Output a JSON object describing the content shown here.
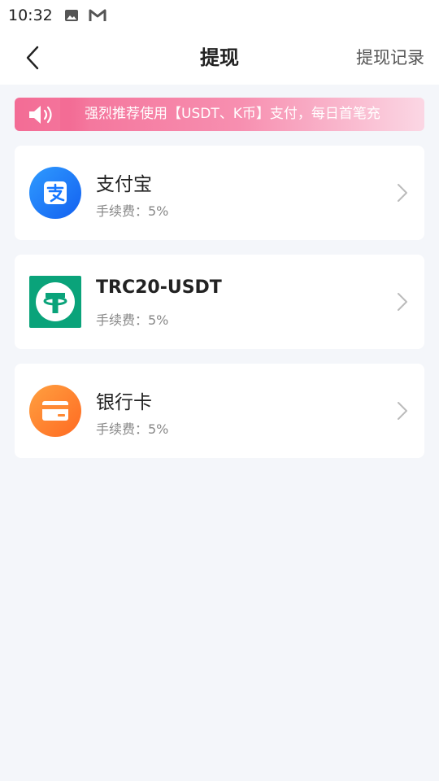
{
  "status_bar": {
    "time": "10:32",
    "icons": [
      "image-icon",
      "gmail-icon"
    ]
  },
  "header": {
    "title": "提现",
    "right_link": "提现记录",
    "back_icon": "chevron-left-icon"
  },
  "notice": {
    "icon": "speaker-icon",
    "text": "强烈推荐使用【USDT、K币】支付，每日首笔充"
  },
  "methods": [
    {
      "name": "支付宝",
      "fee_label": "手续费：5%",
      "icon": "alipay-icon",
      "color": "#1677ff"
    },
    {
      "name": "TRC20-USDT",
      "fee_label": "手续费：5%",
      "icon": "tether-icon",
      "color": "#0aa37a"
    },
    {
      "name": "银行卡",
      "fee_label": "手续费：5%",
      "icon": "bank-card-icon",
      "color": "#ff7a2a"
    }
  ],
  "colors": {
    "background": "#f4f6fa",
    "notice_gradient_start": "#f36c95",
    "alipay": "#1677ff",
    "tether": "#0aa37a",
    "bank": "#ff7a2a"
  }
}
